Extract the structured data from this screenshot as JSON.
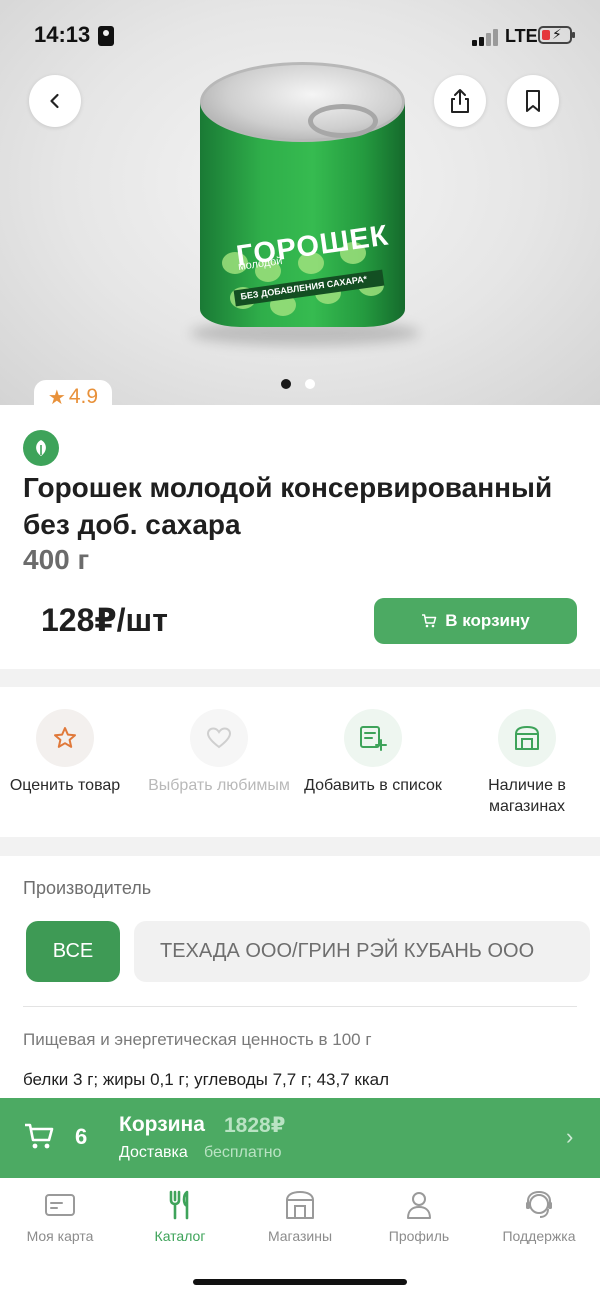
{
  "status_bar": {
    "time": "14:13",
    "network": "LTE"
  },
  "hero": {
    "image_alt": "Горошек молодой консервированный",
    "can_title": "ГОРОШЕК",
    "can_subtitle": "молодой",
    "can_strip": "БЕЗ ДОБАВЛЕНИЯ САХАРА*",
    "can_label": "консервированный"
  },
  "product": {
    "rating": "4.9",
    "title": "Горошек молодой консервированный без доб. сахара",
    "weight": "400 г",
    "price": "128₽/шт",
    "cart_button": "В корзину"
  },
  "actions": [
    {
      "label": "Оценить товар",
      "icon": "star-icon",
      "enabled": true
    },
    {
      "label": "Выбрать любимым",
      "icon": "heart-icon",
      "enabled": false
    },
    {
      "label": "Добавить в список",
      "icon": "list-add-icon",
      "enabled": true
    },
    {
      "label": "Наличие в магазинах",
      "icon": "store-icon",
      "enabled": true
    }
  ],
  "manufacturer": {
    "title": "Производитель",
    "all_chip": "ВСЕ",
    "name": "ТЕХАДА ООО/ГРИН РЭЙ КУБАНЬ ООО"
  },
  "nutrition": {
    "title": "Пищевая и энергетическая ценность в 100 г",
    "text": "белки 3 г; жиры 0,1 г; углеводы 7,7 г; 43,7 ккал"
  },
  "cart_bar": {
    "count": "6",
    "label": "Корзина",
    "total": "1828₽",
    "delivery_label": "Доставка",
    "delivery_value": "бесплатно"
  },
  "tabs": [
    {
      "label": "Моя карта",
      "icon": "card-icon",
      "active": false
    },
    {
      "label": "Каталог",
      "icon": "cutlery-icon",
      "active": true
    },
    {
      "label": "Магазины",
      "icon": "store-icon",
      "active": false
    },
    {
      "label": "Профиль",
      "icon": "profile-icon",
      "active": false
    },
    {
      "label": "Поддержка",
      "icon": "support-icon",
      "active": false
    }
  ],
  "colors": {
    "brand_green": "#4caa63",
    "dark_green": "#3e9a55",
    "rating_orange": "#e8913a"
  }
}
